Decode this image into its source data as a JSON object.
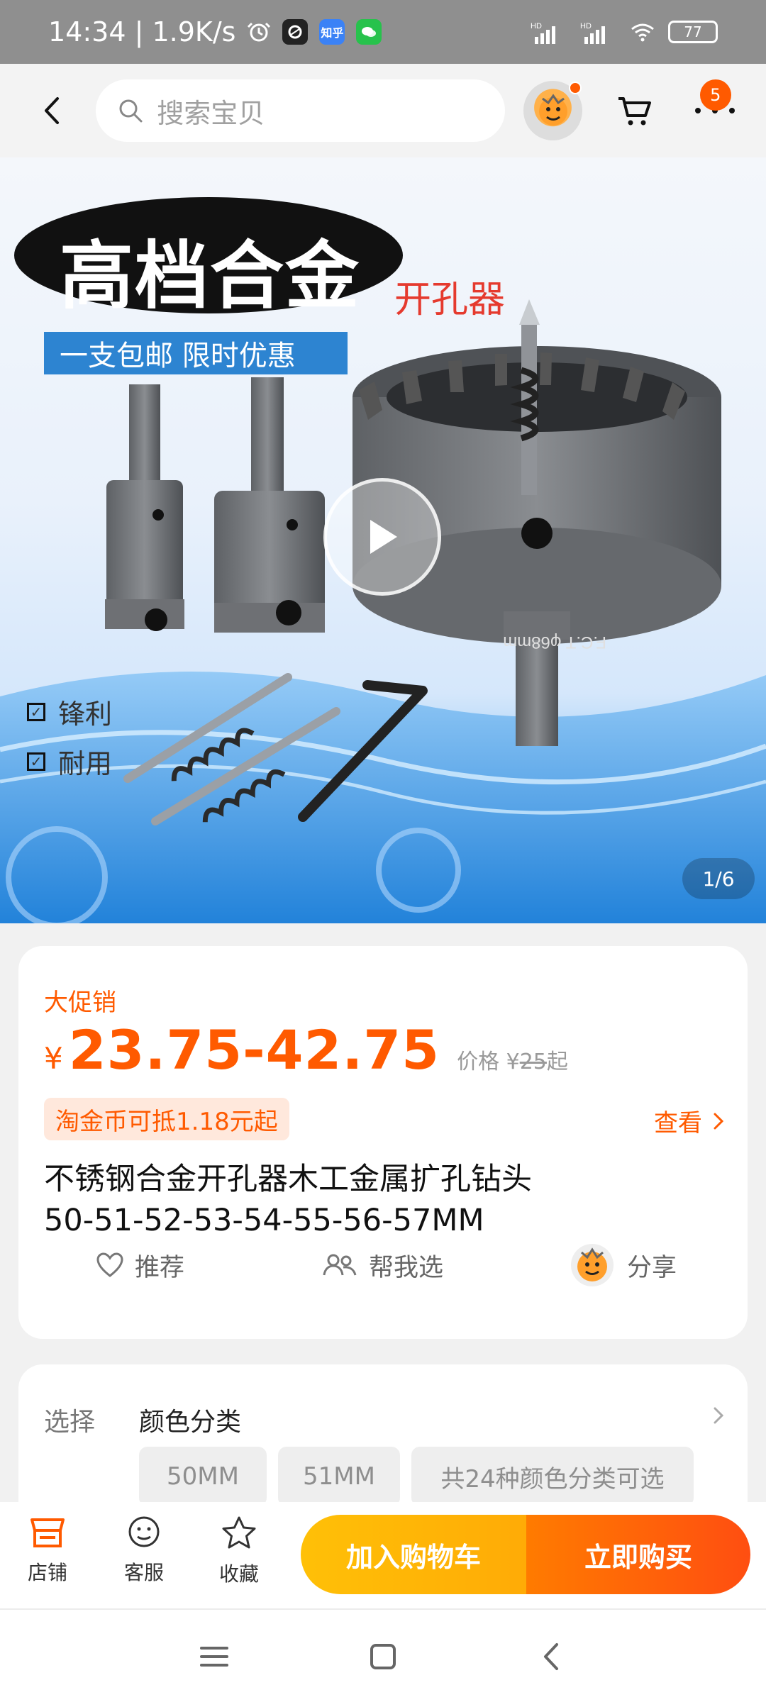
{
  "status_bar": {
    "time_speed": "14:34 | 1.9K/s",
    "zhihu_badge": "知乎",
    "battery": "77"
  },
  "header": {
    "search_placeholder": "搜索宝贝",
    "cart_count": "5"
  },
  "hero": {
    "main_title": "高档合金",
    "subtitle": "开孔器",
    "banner": "一支包邮 限时优惠",
    "features": [
      "锋利",
      "耐用"
    ],
    "image_counter": "1/6"
  },
  "product": {
    "promo_label": "大促销",
    "currency": "¥",
    "price_range": "23.75-42.75",
    "original_price_prefix": "价格 ¥",
    "original_price": "25",
    "original_price_suffix": "起",
    "coupon_text": "淘金币可抵1.18元起",
    "view_link": "查看",
    "title_line1": "不锈钢合金开孔器木工金属扩孔钻头",
    "title_line2": "50-51-52-53-54-55-56-57MM",
    "actions": {
      "recommend": "推荐",
      "help_choose": "帮我选",
      "share": "分享"
    }
  },
  "selection": {
    "label": "选择",
    "value": "颜色分类",
    "options": [
      "50MM",
      "51MM",
      "共24种颜色分类可选"
    ]
  },
  "bottom_bar": {
    "shop": "店铺",
    "service": "客服",
    "favorite": "收藏",
    "add_to_cart": "加入购物车",
    "buy_now": "立即购买"
  },
  "theme": {
    "accent": "#FF5A00",
    "yellow": "#FFC007",
    "blue_banner": "#2D84D1"
  }
}
